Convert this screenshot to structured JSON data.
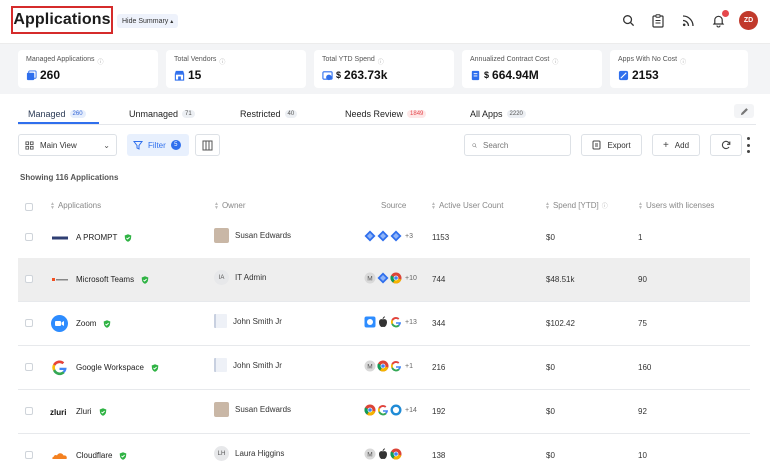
{
  "header": {
    "title": "Applications",
    "hide_summary": "Hide Summary",
    "avatar_initials": "ZD"
  },
  "summary": [
    {
      "label": "Managed Applications",
      "value": "260",
      "currency": "",
      "icon": "apps-icon"
    },
    {
      "label": "Total Vendors",
      "value": "15",
      "currency": "",
      "icon": "vendor-icon"
    },
    {
      "label": "Total YTD Spend",
      "value": "263.73k",
      "currency": "$",
      "icon": "spend-icon"
    },
    {
      "label": "Annualized Contract Cost",
      "value": "664.94M",
      "currency": "$",
      "icon": "contract-icon"
    },
    {
      "label": "Apps With No Cost",
      "value": "2153",
      "currency": "",
      "icon": "no-cost-icon"
    }
  ],
  "tabs": [
    {
      "label": "Managed",
      "count": "260"
    },
    {
      "label": "Unmanaged",
      "count": "71"
    },
    {
      "label": "Restricted",
      "count": "40"
    },
    {
      "label": "Needs Review",
      "count": "1849"
    },
    {
      "label": "All Apps",
      "count": "2220"
    }
  ],
  "toolbar": {
    "view": "Main View",
    "filter": "Filter",
    "filter_count": "5",
    "search_placeholder": "Search",
    "export": "Export",
    "add": "Add"
  },
  "showing": "Showing 116 Applications",
  "columns": {
    "applications": "Applications",
    "owner": "Owner",
    "source": "Source",
    "active_users": "Active User Count",
    "spend": "Spend [YTD]",
    "licenses": "Users with licenses"
  },
  "rows": [
    {
      "name": "A PROMPT",
      "owner": "Susan Edwards",
      "owner_avatar": "photo",
      "owner_initials": "",
      "sources": [
        "diamond",
        "diamond",
        "diamond"
      ],
      "more": "+3",
      "users": "1153",
      "spend": "$0",
      "licenses": "1"
    },
    {
      "name": "Microsoft Teams",
      "owner": "IT Admin",
      "owner_avatar": "init",
      "owner_initials": "IA",
      "sources": [
        "m-circle",
        "diamond",
        "chrome"
      ],
      "more": "+10",
      "users": "744",
      "spend": "$48.51k",
      "licenses": "90"
    },
    {
      "name": "Zoom",
      "owner": "John Smith Jr",
      "owner_avatar": "flag",
      "owner_initials": "",
      "sources": [
        "blue-square",
        "apple",
        "google"
      ],
      "more": "+13",
      "users": "344",
      "spend": "$102.42",
      "licenses": "75"
    },
    {
      "name": "Google Workspace",
      "owner": "John Smith Jr",
      "owner_avatar": "flag",
      "owner_initials": "",
      "sources": [
        "m-circle",
        "chrome",
        "google"
      ],
      "more": "+1",
      "users": "216",
      "spend": "$0",
      "licenses": "160"
    },
    {
      "name": "Zluri",
      "owner": "Susan Edwards",
      "owner_avatar": "photo",
      "owner_initials": "",
      "sources": [
        "chrome",
        "google",
        "ring"
      ],
      "more": "+14",
      "users": "192",
      "spend": "$0",
      "licenses": "92"
    },
    {
      "name": "Cloudflare",
      "owner": "Laura Higgins",
      "owner_avatar": "init",
      "owner_initials": "LH",
      "sources": [
        "m-circle",
        "apple",
        "chrome"
      ],
      "more": "",
      "users": "138",
      "spend": "$0",
      "licenses": "10"
    }
  ]
}
